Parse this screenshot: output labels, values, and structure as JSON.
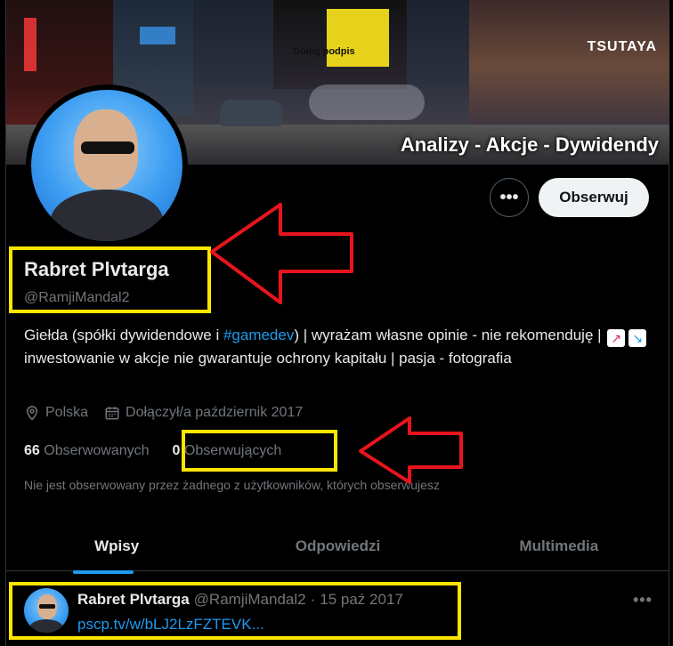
{
  "banner": {
    "caption": "Analizy - Akcje - Dywidendy",
    "store_sign": "TSUTAYA",
    "overlay_text": "Dodaj podpis"
  },
  "profile": {
    "name": "Rabret Plvtarga",
    "handle": "@RamjiMandal2",
    "bio_parts": {
      "before_tag": "Giełda (spółki dywidendowe i ",
      "hashtag": "#gamedev",
      "after_tag": ") | wyrażam własne opinie - nie rekomenduję | ",
      "after_emoji": "inwestowanie w akcje nie gwarantuje ochrony kapitału | pasja - fotografia"
    },
    "location": "Polska",
    "joined": "Dołączył/a październik 2017",
    "following_count": "66",
    "following_label": "Obserwowanych",
    "followers_count": "0",
    "followers_label": "Obserwujących",
    "not_followed_note": "Nie jest obserwowany przez żadnego z użytkowników, których obserwujesz"
  },
  "actions": {
    "more_label": "•••",
    "follow_label": "Obserwuj"
  },
  "tabs": [
    {
      "label": "Wpisy",
      "active": true
    },
    {
      "label": "Odpowiedzi",
      "active": false
    },
    {
      "label": "Multimedia",
      "active": false
    }
  ],
  "post": {
    "author": "Rabret Plvtarga",
    "handle": "@RamjiMandal2",
    "separator": "·",
    "date": "15 paź 2017",
    "link": "pscp.tv/w/bLJ2LzFZTEVK...",
    "more_label": "•••"
  },
  "colors": {
    "highlight": "#ffe600",
    "arrow": "#e8141c",
    "accent": "#1d9bf0",
    "background": "#000000"
  },
  "icons": {
    "location": "location-pin-icon",
    "joined": "calendar-icon",
    "emoji_up": "chart-increasing-icon",
    "emoji_down": "chart-decreasing-icon"
  }
}
